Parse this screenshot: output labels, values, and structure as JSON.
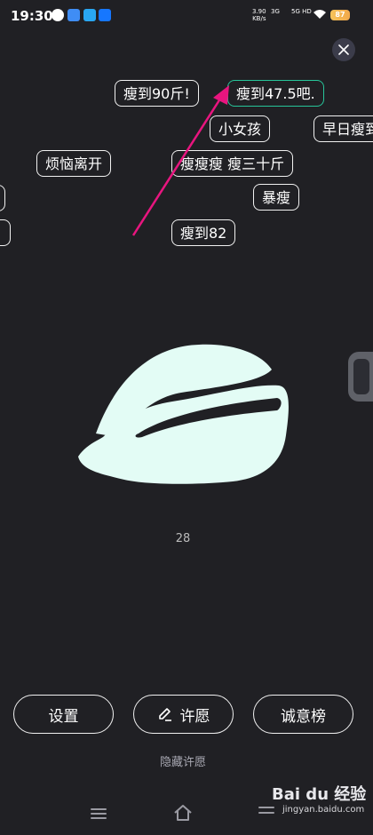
{
  "status_bar": {
    "time": "19:30",
    "net_speed_value": "3.90",
    "net_speed_unit": "KB/s",
    "signal1": "3G",
    "signal2": "5G HD",
    "battery": "87"
  },
  "wishes": [
    {
      "text": "瘦到90斤!"
    },
    {
      "text": "瘦到47.5吧."
    },
    {
      "text": "小女孩"
    },
    {
      "text": "早日瘦到"
    },
    {
      "text": "烦恼离开"
    },
    {
      "text": "瘦瘦瘦 瘦三十斤"
    },
    {
      "text": "暴瘦"
    },
    {
      "text": "瘦到82"
    }
  ],
  "count": "28",
  "buttons": {
    "settings": "设置",
    "wish": "许愿",
    "ranking": "诚意榜"
  },
  "hide_wish": "隐藏许愿",
  "colors": {
    "background": "#202024",
    "lips": "#e3fcf5",
    "accent_border": "#27c59a",
    "annotation_arrow": "#e8157f"
  },
  "watermark": {
    "brand": "Bai du 经验",
    "url": "jingyan.baidu.com"
  }
}
